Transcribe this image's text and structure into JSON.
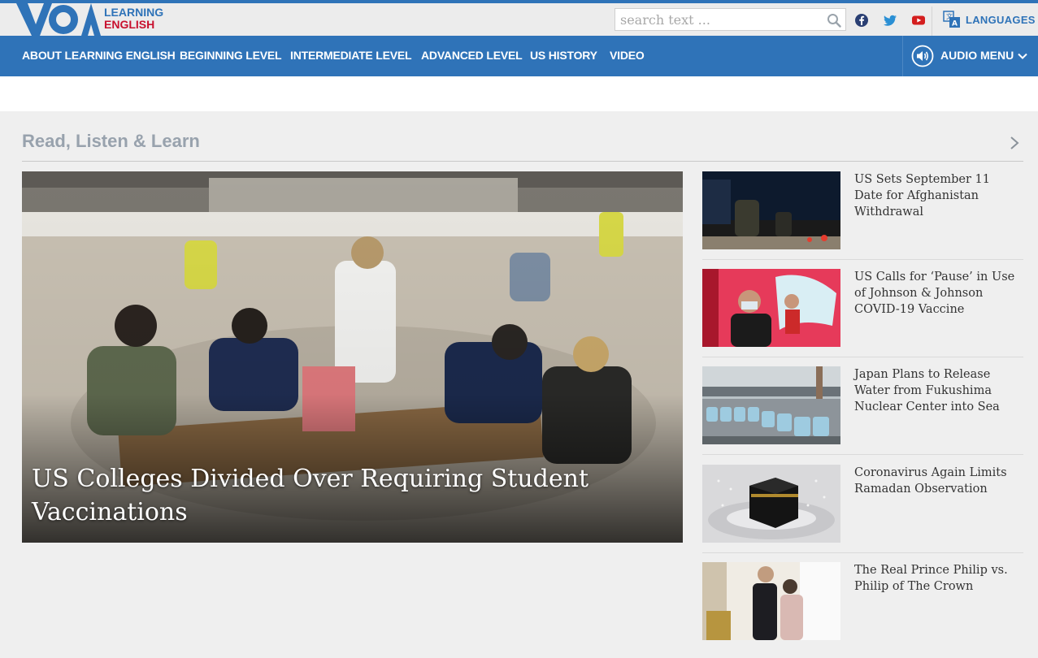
{
  "brand": {
    "logo_mark": "VOA",
    "line1": "LEARNING",
    "line2": "ENGLISH",
    "blue": "#2f73b8",
    "red": "#c8102e"
  },
  "search": {
    "placeholder": "search text ...",
    "icon": "search-icon"
  },
  "social": [
    "facebook-icon",
    "twitter-icon",
    "youtube-icon"
  ],
  "languages": {
    "label": "LANGUAGES",
    "icon": "languages-icon"
  },
  "nav": {
    "items": [
      "ABOUT LEARNING ENGLISH",
      "BEGINNING LEVEL",
      "INTERMEDIATE LEVEL",
      "ADVANCED LEVEL",
      "US HISTORY",
      "VIDEO"
    ],
    "audio_menu": "AUDIO MENU"
  },
  "section": {
    "title": "Read, Listen & Learn",
    "hero": {
      "headline": "US Colleges Divided Over Requiring Student Vaccinations"
    },
    "stories": [
      {
        "headline": "US Sets September 11 Date for Afghanistan Withdrawal"
      },
      {
        "headline": "US Calls for ‘Pause’ in Use of Johnson & Johnson COVID-19 Vaccine"
      },
      {
        "headline": "Japan Plans to Release Water from Fukushima Nuclear Center into Sea"
      },
      {
        "headline": "Coronavirus Again Limits Ramadan Observation"
      },
      {
        "headline": "The Real Prince Philip vs. Philip of The Crown"
      }
    ]
  }
}
